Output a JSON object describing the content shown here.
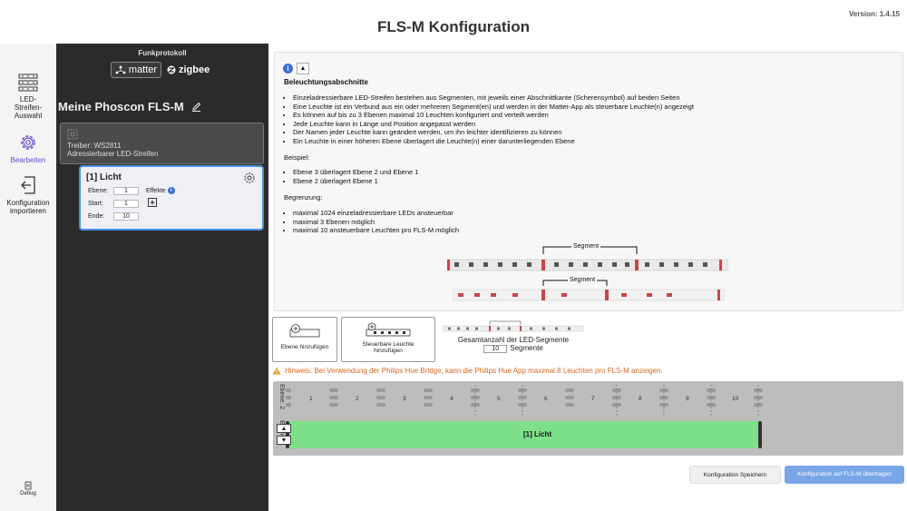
{
  "header": {
    "title": "FLS-M Konfiguration",
    "version": "Version: 1.4.15"
  },
  "sidebar": {
    "items": [
      {
        "label": "LED-Streifen-Auswahl",
        "icon": "led-strip-icon"
      },
      {
        "label": "Bearbeiten",
        "icon": "gear-icon",
        "active": true
      },
      {
        "label": "Konfiguration importieren",
        "icon": "import-icon"
      }
    ],
    "debug": "Debug"
  },
  "panel": {
    "protocol_title": "Funkprotokoll",
    "matter_label": "matter",
    "zigbee_label": "zigbee",
    "device_name": "Meine Phoscon FLS-M",
    "driver_line1": "Treiber: WS2811",
    "driver_line2": "Adressierbarer LED-Streifen",
    "light": {
      "title": "[1]  Licht",
      "ebene_label": "Ebene:",
      "ebene": "1",
      "start_label": "Start:",
      "start": "1",
      "ende_label": "Ende:",
      "ende": "10",
      "effekte_label": "Effekte"
    }
  },
  "info": {
    "title": "Beleuchtungsabschnitte",
    "bullets": [
      "Einzeladressierbare LED-Streifen bestehen aus Segmenten, mit jeweils einer Abschnittkante (Scherensymbol) auf beiden Seiten",
      "Eine Leuchte ist ein Verbund aus ein oder mehreren Segment(en) und werden in der Matter-App als steuerbare Leuchte(n) angezeigt",
      "Es können auf bis zu 3 Ebenen maximal 10 Leuchten konfiguriert und verteilt werden",
      "Jede Leuchte kann in Länge und Position angepasst werden",
      "Der Namen jeder Leuchte kann geändert werden, um ihn leichter identifizieren zu können",
      "Ein Leuchte in einer höheren Ebene überlagert die Leuchte(n) einer darunterliegenden Ebene"
    ],
    "example_label": "Beispiel:",
    "example_bullets": [
      "Ebene 3 überlagert Ebene 2 und Ebene 1",
      "Ebene 2 überlagert Ebene 1"
    ],
    "limit_label": "Begrenzung:",
    "limit_bullets": [
      "maximal 1024 einzeladressierbare LEDs ansteuerbar",
      "maximal 3 Ebenen möglich",
      "maximal 10 ansteuerbare Leuchten pro FLS-M möglich"
    ],
    "segment_label": "Segment"
  },
  "actions": {
    "add_ebene": "Ebene hinzufügen",
    "add_leuchte": "Steuerbare Leuchte hinzufügen",
    "segment_total_label": "Gesamtanzahl der LED-Segmente",
    "segment_total": "10",
    "segment_unit": "Segmente",
    "hinweis": "Hinweis: Bei Verwendung der Philips Hue Bridge, kann die Philips Hue App maximal 8 Leuchten pro FLS-M anzeigen."
  },
  "timeline": {
    "layer2_label": "Ebene: 2",
    "layer1_label": "Ebene: 1",
    "segments": [
      "1",
      "2",
      "3",
      "4",
      "5",
      "6",
      "7",
      "8",
      "9",
      "10"
    ],
    "light_label": "[1]  Licht",
    "bar_color": "#7ee08a"
  },
  "footer": {
    "save": "Konfiguration Speichern",
    "upload": "Konfiguration auf FLS-M übertragen"
  },
  "colors": {
    "accent": "#6a4bc6",
    "primary_button": "#7aa6e8",
    "warning": "#d9661f"
  }
}
